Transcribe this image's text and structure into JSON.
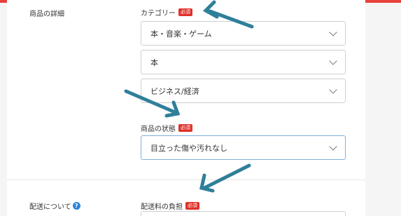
{
  "colors": {
    "accent_bar": "#e8403b",
    "required_badge": "#e0312b",
    "arrow": "#2f7f9a",
    "help_icon": "#2d86d8"
  },
  "details_section": {
    "label": "商品の詳細",
    "category": {
      "label": "カテゴリー",
      "required": "必須",
      "level1": "本・音楽・ゲーム",
      "level2": "本",
      "level3": "ビジネス/経済"
    },
    "condition": {
      "label": "商品の状態",
      "required": "必須",
      "value": "目立った傷や汚れなし"
    }
  },
  "shipping_section": {
    "label": "配送について",
    "help_icon": "?",
    "fee_burden": {
      "label": "配送料の負担",
      "required": "必須"
    }
  }
}
